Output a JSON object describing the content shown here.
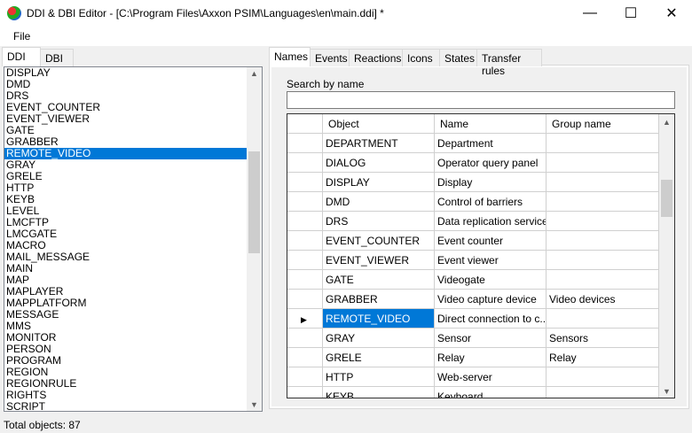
{
  "window": {
    "title": "DDI & DBI Editor - [C:\\Program Files\\Axxon PSIM\\Languages\\en\\main.ddi] *",
    "min": "—",
    "max": "☐",
    "close": "✕"
  },
  "menu": [
    "File"
  ],
  "left_tabs": [
    "DDI",
    "DBI"
  ],
  "left_list": {
    "items": [
      "DISPLAY",
      "DMD",
      "DRS",
      "EVENT_COUNTER",
      "EVENT_VIEWER",
      "GATE",
      "GRABBER",
      "REMOTE_VIDEO",
      "GRAY",
      "GRELE",
      "HTTP",
      "KEYB",
      "LEVEL",
      "LMCFTP",
      "LMCGATE",
      "MACRO",
      "MAIL_MESSAGE",
      "MAIN",
      "MAP",
      "MAPLAYER",
      "MAPPLATFORM",
      "MESSAGE",
      "MMS",
      "MONITOR",
      "PERSON",
      "PROGRAM",
      "REGION",
      "REGIONRULE",
      "RIGHTS",
      "SCRIPT"
    ],
    "selected": "REMOTE_VIDEO"
  },
  "right_tabs": [
    "Names",
    "Events",
    "Reactions",
    "Icons",
    "States",
    "Transfer rules"
  ],
  "search": {
    "label": "Search by name",
    "value": ""
  },
  "grid": {
    "columns": [
      "Object",
      "Name",
      "Group name"
    ],
    "rows": [
      [
        "DEPARTMENT",
        "Department",
        ""
      ],
      [
        "DIALOG",
        "Operator query panel",
        ""
      ],
      [
        "DISPLAY",
        "Display",
        ""
      ],
      [
        "DMD",
        "Control of barriers",
        ""
      ],
      [
        "DRS",
        "Data replication service",
        ""
      ],
      [
        "EVENT_COUNTER",
        "Event counter",
        ""
      ],
      [
        "EVENT_VIEWER",
        "Event viewer",
        ""
      ],
      [
        "GATE",
        "Videogate",
        ""
      ],
      [
        "GRABBER",
        "Video capture device",
        "Video devices"
      ],
      [
        "REMOTE_VIDEO",
        "Direct connection to c...",
        ""
      ],
      [
        "GRAY",
        "Sensor",
        "Sensors"
      ],
      [
        "GRELE",
        "Relay",
        "Relay"
      ],
      [
        "HTTP",
        "Web-server",
        ""
      ],
      [
        "KEYB",
        "Keyboard",
        ""
      ]
    ],
    "current_row": 9
  },
  "status": "Total objects: 87"
}
